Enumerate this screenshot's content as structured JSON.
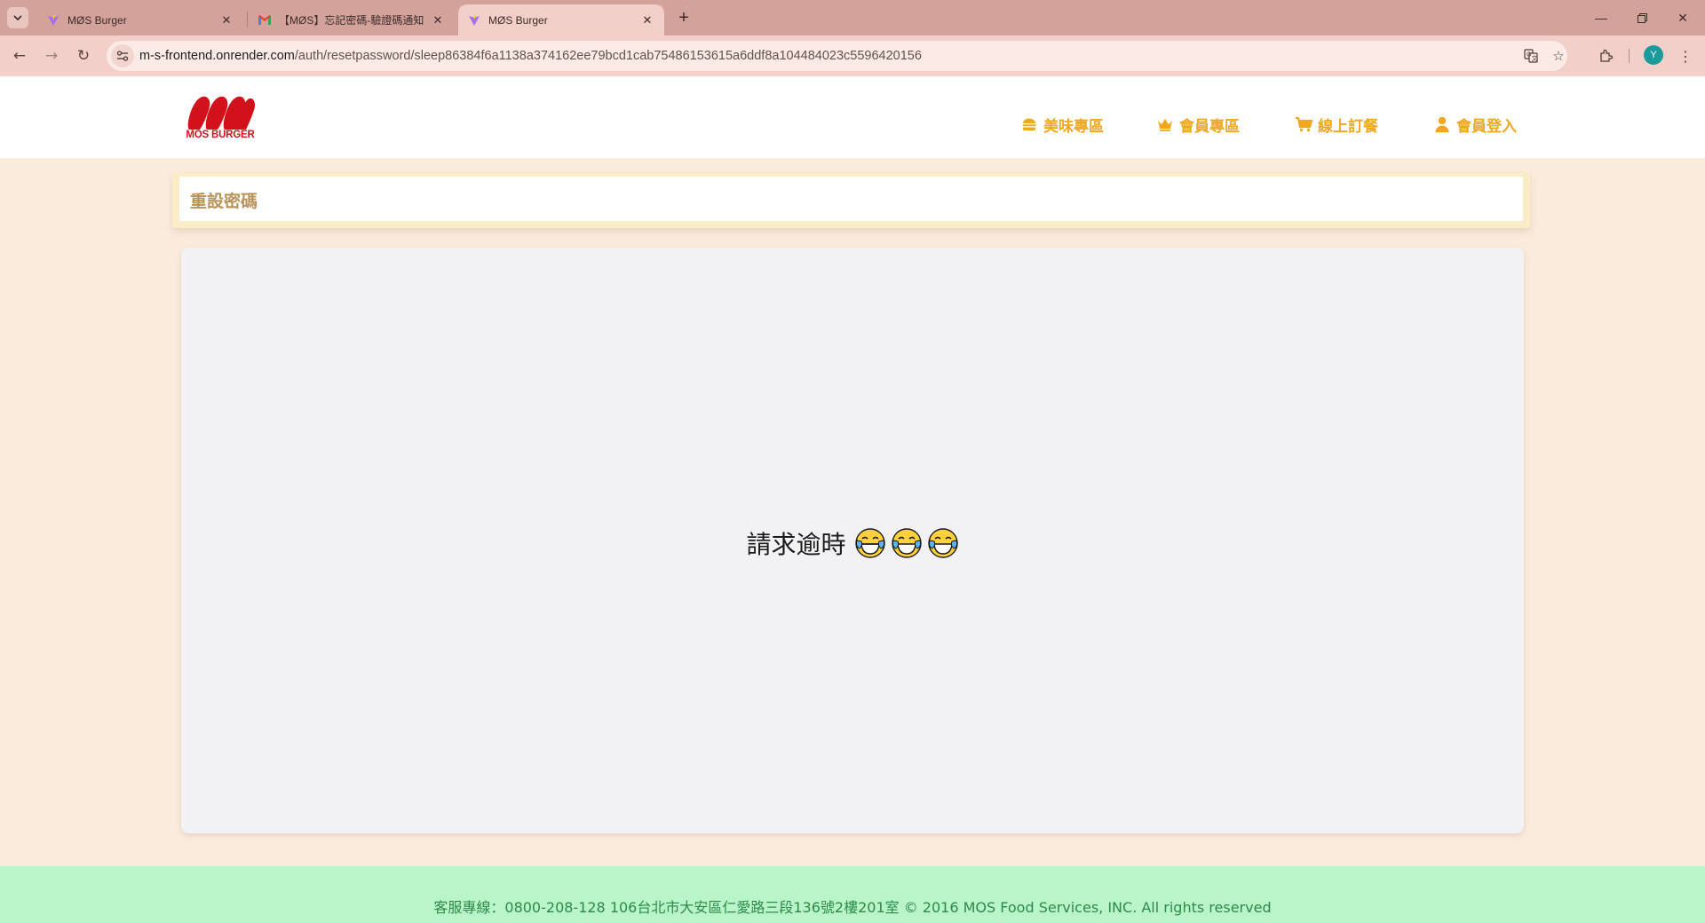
{
  "browser": {
    "tabs": [
      {
        "title": "MØS Burger",
        "active": false
      },
      {
        "title": "【MØS】忘記密碼-驗證碼通知",
        "active": false
      },
      {
        "title": "MØS Burger",
        "active": true
      }
    ],
    "url_host": "m-s-frontend.onrender.com",
    "url_path": "/auth/resetpassword/sleep86384f6a1138a374162ee79bcd1cab75486153615a6ddf8a104484023c5596420156",
    "profile_initial": "Y"
  },
  "header": {
    "logo_text": "MOS BURGER",
    "menu": [
      {
        "label": "美味專區",
        "icon": "burger-icon"
      },
      {
        "label": "會員專區",
        "icon": "crown-icon"
      },
      {
        "label": "線上訂餐",
        "icon": "cart-icon"
      },
      {
        "label": "會員登入",
        "icon": "user-icon"
      }
    ]
  },
  "page": {
    "title": "重設密碼",
    "message": "請求逾時",
    "emoji_name": "face-with-tears-of-joy"
  },
  "footer": {
    "text": "客服專線：0800-208-128 106台北市大安區仁愛路三段136號2樓201室 © 2016 MOS Food Services, INC. All rights reserved"
  },
  "colors": {
    "brand_red": "#d3111a",
    "menu_gold": "#f0a820",
    "title_text": "#b8935a",
    "page_bg": "#faebdc",
    "footer_bg": "#b9f5c8",
    "footer_text": "#2e8a4a"
  }
}
